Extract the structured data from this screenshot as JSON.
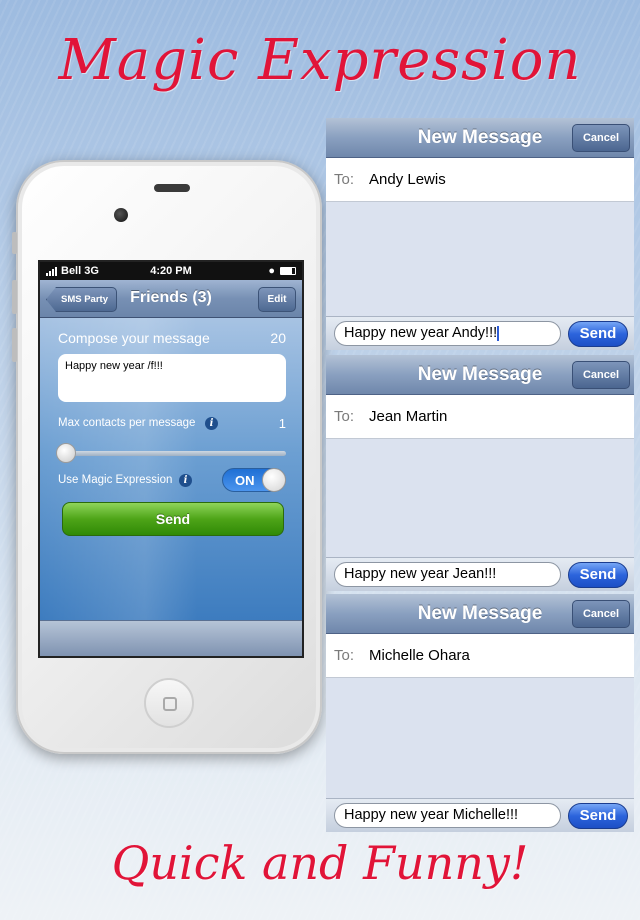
{
  "headline": {
    "top": "Magic Expression",
    "bottom": "Quick and Funny!"
  },
  "phone": {
    "status": {
      "carrier": "Bell 3G",
      "time": "4:20 PM"
    },
    "nav": {
      "back_label": "SMS Party",
      "title": "Friends (3)",
      "edit_label": "Edit"
    },
    "compose": {
      "label": "Compose your message",
      "count": "20",
      "text": "Happy new year /f!!!",
      "max_label": "Max contacts per message",
      "max_value": "1",
      "slider_level": 0,
      "magic_label": "Use Magic Expression",
      "toggle_label": "ON",
      "send_label": "Send"
    }
  },
  "messages": [
    {
      "title": "New Message",
      "cancel": "Cancel",
      "to_label": "To:",
      "to_name": "Andy Lewis",
      "text": "Happy new year Andy!!!",
      "send": "Send"
    },
    {
      "title": "New Message",
      "cancel": "Cancel",
      "to_label": "To:",
      "to_name": "Jean Martin",
      "text": "Happy new year Jean!!!",
      "send": "Send"
    },
    {
      "title": "New Message",
      "cancel": "Cancel",
      "to_label": "To:",
      "to_name": "Michelle Ohara",
      "text": "Happy new year Michelle!!!",
      "send": "Send"
    }
  ],
  "colors": {
    "headline": "#e11438",
    "send_green": "#4ea418",
    "send_blue": "#2c64dc",
    "toggle_on": "#1f6fd4"
  }
}
